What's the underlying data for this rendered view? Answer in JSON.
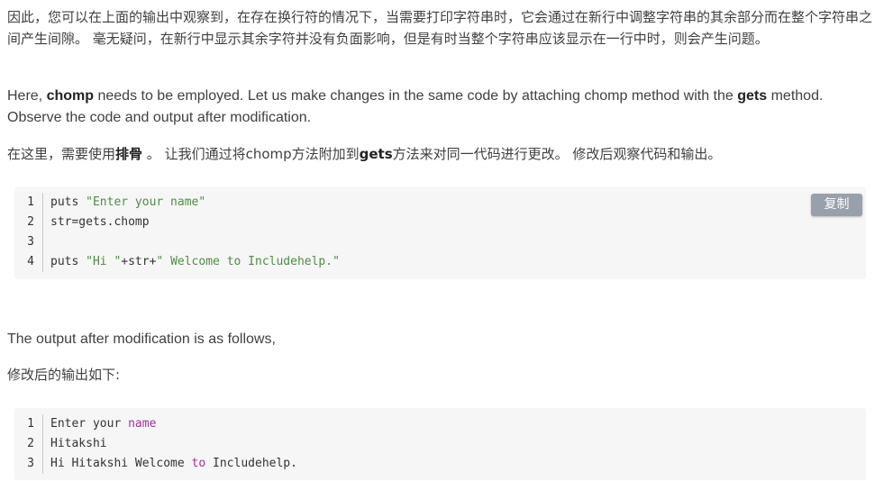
{
  "article": {
    "p1": "因此，您可以在上面的输出中观察到，在存在换行符的情况下，当需要打印字符串时，它会通过在新行中调整字符串的其余部分而在整个字符串之间产生间隙。 毫无疑问，在新行中显示其余字符并没有负面影响，但是有时当整个字符串应该显示在一行中时，则会产生问题。",
    "p2": {
      "a": "Here, ",
      "b": "chomp",
      "c": " needs to be employed. Let us make changes in the same code by attaching chomp method with the ",
      "d": "gets",
      "e": " method. Observe the code and output after modification."
    },
    "p3": {
      "a": "在这里，需要使用",
      "b": "排骨",
      "c": " 。 让我们通过将chomp方法附加到",
      "d": "gets",
      "e": "方法来对同一代码进行更改。 修改后观察代码和输出。"
    },
    "p4": "The output after modification is as follows,",
    "p5": "修改后的输出如下:"
  },
  "code_block_1": {
    "copy_label": "复制",
    "lines": [
      {
        "num": "1",
        "t1": "puts ",
        "t2": "\"Enter your name\""
      },
      {
        "num": "2",
        "t1": "str=gets.chomp",
        "t2": ""
      },
      {
        "num": "3",
        "t1": "",
        "t2": ""
      },
      {
        "num": "4",
        "t1": "puts ",
        "t2": "\"Hi \"",
        "t3": "+str+",
        "t4": "\" Welcome to Includehelp.\""
      }
    ]
  },
  "code_block_2": {
    "lines": [
      {
        "num": "1",
        "t1": "Enter your ",
        "t2": "name"
      },
      {
        "num": "2",
        "t1": "Hitakshi"
      },
      {
        "num": "3",
        "t1": "Hi Hitakshi Welcome ",
        "t2": "to",
        "t3": " Includehelp."
      }
    ]
  },
  "colors": {
    "string": "#508c46",
    "keyword": "#a02ea0",
    "code_bg": "#f6f6f6",
    "copy_button_bg": "#98a0ac"
  }
}
